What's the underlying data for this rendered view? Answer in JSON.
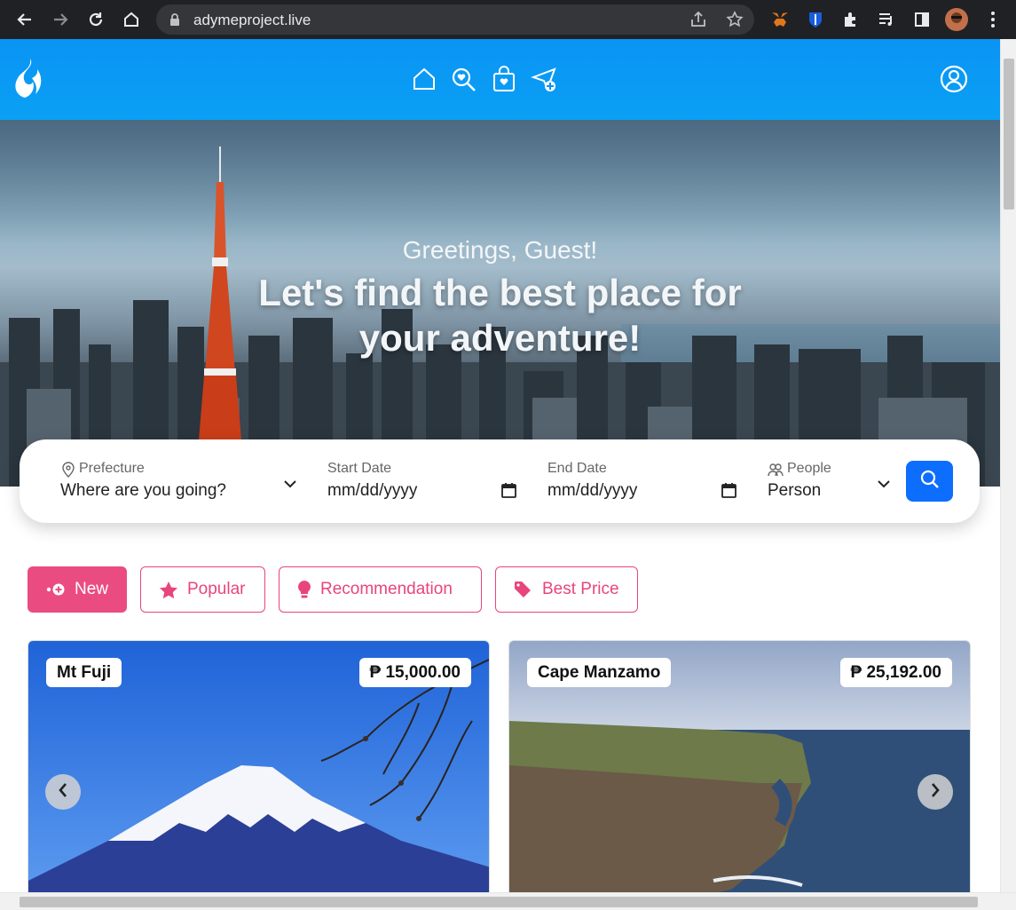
{
  "browser": {
    "url": "adymeproject.live"
  },
  "hero": {
    "greeting": "Greetings, Guest!",
    "headline_line1": "Let's find the best place for",
    "headline_line2": "your adventure!"
  },
  "search": {
    "prefecture_label": "Prefecture",
    "prefecture_value": "Where are you going?",
    "start_label": "Start Date",
    "start_value": "mm/dd/yyyy",
    "end_label": "End Date",
    "end_value": "mm/dd/yyyy",
    "people_label": "People",
    "people_value": "Person"
  },
  "filters": [
    {
      "label": "New",
      "icon": "new-icon",
      "active": true
    },
    {
      "label": "Popular",
      "icon": "star-icon",
      "active": false
    },
    {
      "label": "Recommendation",
      "icon": "bulb-icon",
      "active": false
    },
    {
      "label": "Best Price",
      "icon": "tag-icon",
      "active": false
    }
  ],
  "cards": [
    {
      "name": "Mt Fuji",
      "price": "₱ 15,000.00"
    },
    {
      "name": "Cape Manzamo",
      "price": "₱ 25,192.00"
    }
  ],
  "colors": {
    "header": "#0a94f3",
    "accent_pink": "#ea4c82",
    "search_button": "#0d6efd"
  }
}
